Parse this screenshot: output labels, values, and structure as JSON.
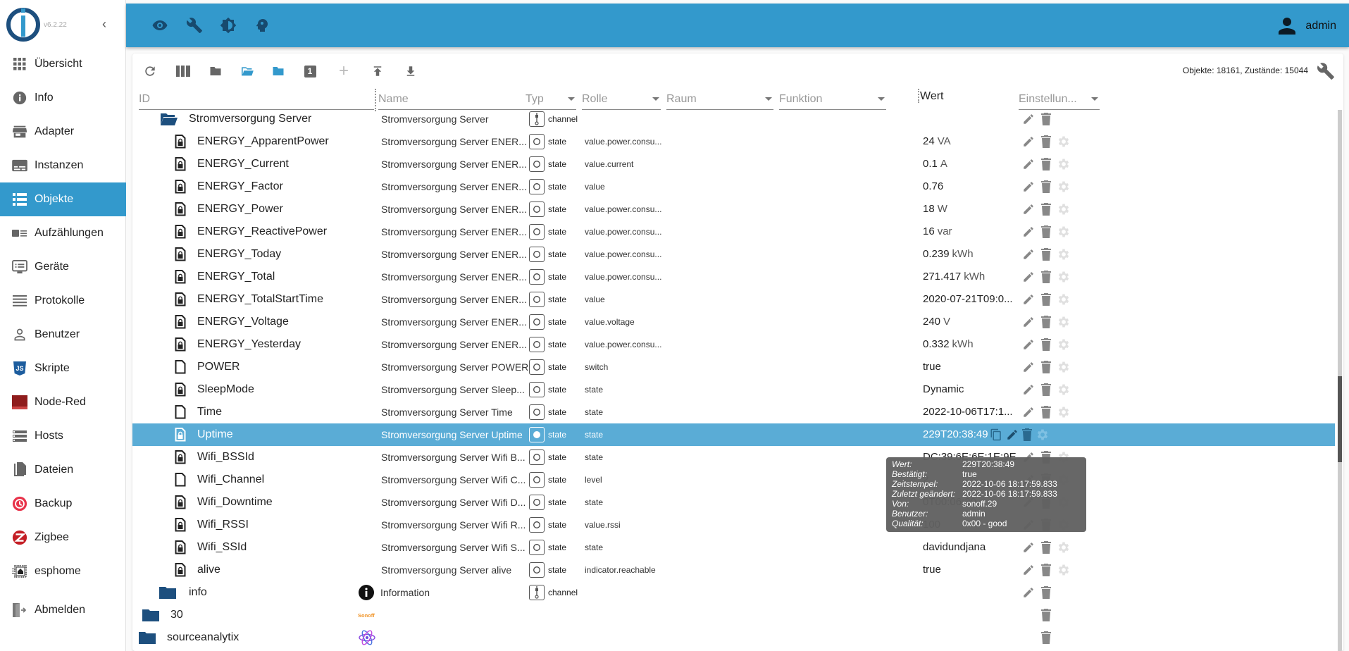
{
  "app": {
    "version": "v6.2.22",
    "user": "admin"
  },
  "sidebar": {
    "items": [
      {
        "label": "Übersicht",
        "icon": "apps-grid-icon",
        "active": false
      },
      {
        "label": "Info",
        "icon": "info-icon",
        "active": false
      },
      {
        "label": "Adapter",
        "icon": "store-icon",
        "active": false
      },
      {
        "label": "Instanzen",
        "icon": "subtitles-icon",
        "active": false
      },
      {
        "label": "Objekte",
        "icon": "list-icon",
        "active": true
      },
      {
        "label": "Aufzählungen",
        "icon": "enum-list-icon",
        "active": false
      },
      {
        "label": "Geräte",
        "icon": "devices-icon",
        "active": false
      },
      {
        "label": "Protokolle",
        "icon": "log-lines-icon",
        "active": false
      },
      {
        "label": "Benutzer",
        "icon": "person-icon",
        "active": false
      },
      {
        "label": "Skripte",
        "icon": "javascript-icon",
        "active": false
      },
      {
        "label": "Node-Red",
        "icon": "node-red-icon",
        "active": false
      },
      {
        "label": "Hosts",
        "icon": "storage-icon",
        "active": false
      },
      {
        "label": "Dateien",
        "icon": "files-icon",
        "active": false
      },
      {
        "label": "Backup",
        "icon": "backup-icon",
        "active": false
      },
      {
        "label": "Zigbee",
        "icon": "zigbee-icon",
        "active": false
      },
      {
        "label": "esphome",
        "icon": "esphome-icon",
        "active": false
      },
      {
        "label": "Abmelden",
        "icon": "logout-icon",
        "active": false
      }
    ]
  },
  "topbar": {
    "icons": [
      "eye-icon",
      "wrench-icon",
      "theme-icon",
      "expert-mode-icon"
    ]
  },
  "toolbar": {
    "icons": [
      "refresh-icon",
      "columns-icon",
      "folder-collapse-icon",
      "folder-open-icon",
      "folder-expand-icon",
      "depth-badge-icon",
      "add-icon",
      "upload-icon",
      "download-icon"
    ],
    "depth_badge": "1",
    "stats": "Objekte: 18161, Zustände: 15044"
  },
  "columns": {
    "id": "ID",
    "name": "Name",
    "typ": "Typ",
    "rolle": "Rolle",
    "raum": "Raum",
    "funktion": "Funktion",
    "wert": "Wert",
    "einstellungen": "Einstellun..."
  },
  "rows": [
    {
      "id": "Stromversorgung Server",
      "icon": "folder-open",
      "level": 1,
      "name": "Stromversorgung Server",
      "typ": "channel",
      "role": "",
      "value": "",
      "unit": "",
      "actions": [
        "edit",
        "delete"
      ]
    },
    {
      "id": "ENERGY_ApparentPower",
      "icon": "file-locked",
      "level": 2,
      "name": "Stromversorgung Server ENER...",
      "typ": "state",
      "role": "value.power.consu...",
      "value": "24",
      "unit": "VA",
      "actions": [
        "edit",
        "delete",
        "settings"
      ]
    },
    {
      "id": "ENERGY_Current",
      "icon": "file-locked",
      "level": 2,
      "name": "Stromversorgung Server ENER...",
      "typ": "state",
      "role": "value.current",
      "value": "0.1",
      "unit": "A",
      "actions": [
        "edit",
        "delete",
        "settings"
      ]
    },
    {
      "id": "ENERGY_Factor",
      "icon": "file-locked",
      "level": 2,
      "name": "Stromversorgung Server ENER...",
      "typ": "state",
      "role": "value",
      "value": "0.76",
      "unit": "",
      "actions": [
        "edit",
        "delete",
        "settings"
      ]
    },
    {
      "id": "ENERGY_Power",
      "icon": "file-locked",
      "level": 2,
      "name": "Stromversorgung Server ENER...",
      "typ": "state",
      "role": "value.power.consu...",
      "value": "18",
      "unit": "W",
      "actions": [
        "edit",
        "delete",
        "settings"
      ]
    },
    {
      "id": "ENERGY_ReactivePower",
      "icon": "file-locked",
      "level": 2,
      "name": "Stromversorgung Server ENER...",
      "typ": "state",
      "role": "value.power.consu...",
      "value": "16",
      "unit": "var",
      "actions": [
        "edit",
        "delete",
        "settings"
      ]
    },
    {
      "id": "ENERGY_Today",
      "icon": "file-locked",
      "level": 2,
      "name": "Stromversorgung Server ENER...",
      "typ": "state",
      "role": "value.power.consu...",
      "value": "0.239",
      "unit": "kWh",
      "actions": [
        "edit",
        "delete",
        "settings"
      ]
    },
    {
      "id": "ENERGY_Total",
      "icon": "file-locked",
      "level": 2,
      "name": "Stromversorgung Server ENER...",
      "typ": "state",
      "role": "value.power.consu...",
      "value": "271.417",
      "unit": "kWh",
      "actions": [
        "edit",
        "delete",
        "settings"
      ]
    },
    {
      "id": "ENERGY_TotalStartTime",
      "icon": "file-locked",
      "level": 2,
      "name": "Stromversorgung Server ENER...",
      "typ": "state",
      "role": "value",
      "value": "2020-07-21T09:0...",
      "unit": "",
      "actions": [
        "edit",
        "delete",
        "settings"
      ]
    },
    {
      "id": "ENERGY_Voltage",
      "icon": "file-locked",
      "level": 2,
      "name": "Stromversorgung Server ENER...",
      "typ": "state",
      "role": "value.voltage",
      "value": "240",
      "unit": "V",
      "actions": [
        "edit",
        "delete",
        "settings"
      ]
    },
    {
      "id": "ENERGY_Yesterday",
      "icon": "file-locked",
      "level": 2,
      "name": "Stromversorgung Server ENER...",
      "typ": "state",
      "role": "value.power.consu...",
      "value": "0.332",
      "unit": "kWh",
      "actions": [
        "edit",
        "delete",
        "settings"
      ]
    },
    {
      "id": "POWER",
      "icon": "file",
      "level": 2,
      "name": "Stromversorgung Server POWER",
      "typ": "state",
      "role": "switch",
      "value": "true",
      "unit": "",
      "actions": [
        "edit",
        "delete",
        "settings"
      ]
    },
    {
      "id": "SleepMode",
      "icon": "file-locked",
      "level": 2,
      "name": "Stromversorgung Server Sleep...",
      "typ": "state",
      "role": "state",
      "value": "Dynamic",
      "unit": "",
      "actions": [
        "edit",
        "delete",
        "settings"
      ]
    },
    {
      "id": "Time",
      "icon": "file",
      "level": 2,
      "name": "Stromversorgung Server Time",
      "typ": "state",
      "role": "state",
      "value": "2022-10-06T17:1...",
      "unit": "",
      "actions": [
        "edit",
        "delete",
        "settings"
      ]
    },
    {
      "id": "Uptime",
      "icon": "file-locked",
      "level": 2,
      "name": "Stromversorgung Server Uptime",
      "typ": "state",
      "role": "state",
      "value": "229T20:38:49",
      "unit": "",
      "selected": true,
      "actions": [
        "copy",
        "edit",
        "delete",
        "settings"
      ]
    },
    {
      "id": "Wifi_BSSId",
      "icon": "file-locked",
      "level": 2,
      "name": "Stromversorgung Server Wifi B...",
      "typ": "state",
      "role": "state",
      "value": "DC:39:6E:6E:1E:9E",
      "unit": "",
      "actions": [
        "edit",
        "delete",
        "settings"
      ]
    },
    {
      "id": "Wifi_Channel",
      "icon": "file",
      "level": 2,
      "name": "Stromversorgung Server Wifi C...",
      "typ": "state",
      "role": "level",
      "value": "2",
      "unit": "",
      "actions": [
        "edit",
        "delete",
        "settings"
      ]
    },
    {
      "id": "Wifi_Downtime",
      "icon": "file-locked",
      "level": 2,
      "name": "Stromversorgung Server Wifi D...",
      "typ": "state",
      "role": "state",
      "value": "0T00:06:20",
      "unit": "",
      "actions": [
        "edit",
        "delete",
        "settings"
      ]
    },
    {
      "id": "Wifi_RSSI",
      "icon": "file-locked",
      "level": 2,
      "name": "Stromversorgung Server Wifi R...",
      "typ": "state",
      "role": "value.rssi",
      "value": "100",
      "unit": "",
      "actions": [
        "edit",
        "delete",
        "settings"
      ]
    },
    {
      "id": "Wifi_SSId",
      "icon": "file-locked",
      "level": 2,
      "name": "Stromversorgung Server Wifi S...",
      "typ": "state",
      "role": "state",
      "value": "davidundjana",
      "unit": "",
      "actions": [
        "edit",
        "delete",
        "settings"
      ]
    },
    {
      "id": "alive",
      "icon": "file-locked",
      "level": 2,
      "name": "Stromversorgung Server alive",
      "typ": "state",
      "role": "indicator.reachable",
      "value": "true",
      "unit": "",
      "actions": [
        "edit",
        "delete",
        "settings"
      ]
    },
    {
      "id": "info",
      "icon": "folder",
      "level": 1,
      "name": "Information",
      "name_icon": "info-circle",
      "typ": "channel",
      "role": "",
      "value": "",
      "unit": "",
      "actions": [
        "edit",
        "delete"
      ]
    },
    {
      "id": "30",
      "icon": "folder",
      "level": 0.5,
      "name": "",
      "name_icon": "sonoff-logo",
      "typ": "",
      "role": "",
      "value": "",
      "unit": "",
      "actions": [
        "delete"
      ]
    },
    {
      "id": "sourceanalytix",
      "icon": "folder",
      "level": 0,
      "name": "",
      "name_icon": "atom-logo",
      "typ": "",
      "role": "",
      "value": "",
      "unit": "",
      "actions": [
        "delete"
      ]
    }
  ],
  "tooltip": {
    "entries": [
      {
        "key": "Wert:",
        "value": "229T20:38:49"
      },
      {
        "key": "Bestätigt:",
        "value": "true"
      },
      {
        "key": "Zeitstempel:",
        "value": "2022-10-06 18:17:59.833"
      },
      {
        "key": "Zuletzt geändert:",
        "value": "2022-10-06 18:17:59.833"
      },
      {
        "key": "Von:",
        "value": "sonoff.29"
      },
      {
        "key": "Benutzer:",
        "value": "admin"
      },
      {
        "key": "Qualität:",
        "value": "0x00 - good"
      }
    ]
  },
  "scroll": {
    "position_fraction": 0.5
  },
  "colors": {
    "primary": "#3399cc",
    "selected_row": "#5aacd6",
    "folder": "#1d4f7e",
    "icon_gray": "#888888"
  }
}
